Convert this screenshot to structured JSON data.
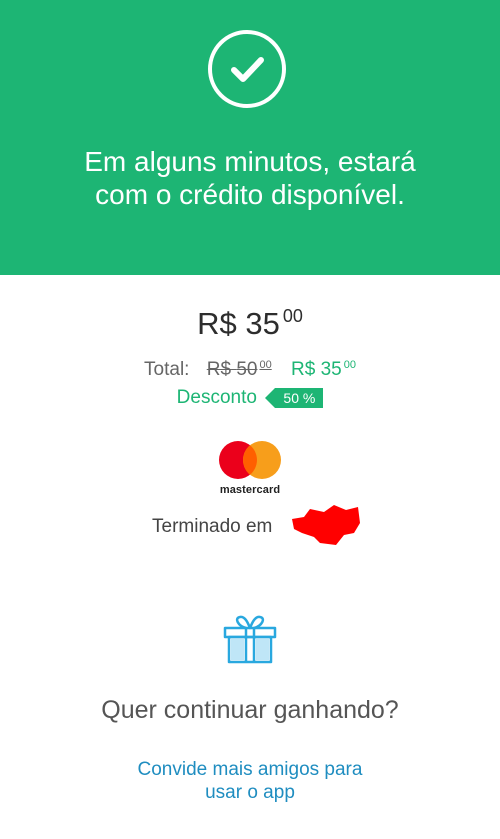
{
  "banner": {
    "line1": "Em alguns minutos, estará",
    "line2": "com o crédito disponível.",
    "icon": "check-icon",
    "color": "#1db574"
  },
  "price": {
    "currency": "R$",
    "amount": "35",
    "cents": "00"
  },
  "total": {
    "label": "Total:",
    "old_currency": "R$",
    "old_amount": "50",
    "old_cents": "00",
    "new_currency": "R$",
    "new_amount": "35",
    "new_cents": "00"
  },
  "discount": {
    "label": "Desconto",
    "badge": "50 %"
  },
  "payment": {
    "brand": "mastercard",
    "card_end_label": "Terminado em"
  },
  "promo": {
    "icon": "gift-icon",
    "title": "Quer continuar ganhando?",
    "link_line1": "Convide mais amigos para",
    "link_line2": "usar o app",
    "link_color": "#1f8dc0"
  }
}
